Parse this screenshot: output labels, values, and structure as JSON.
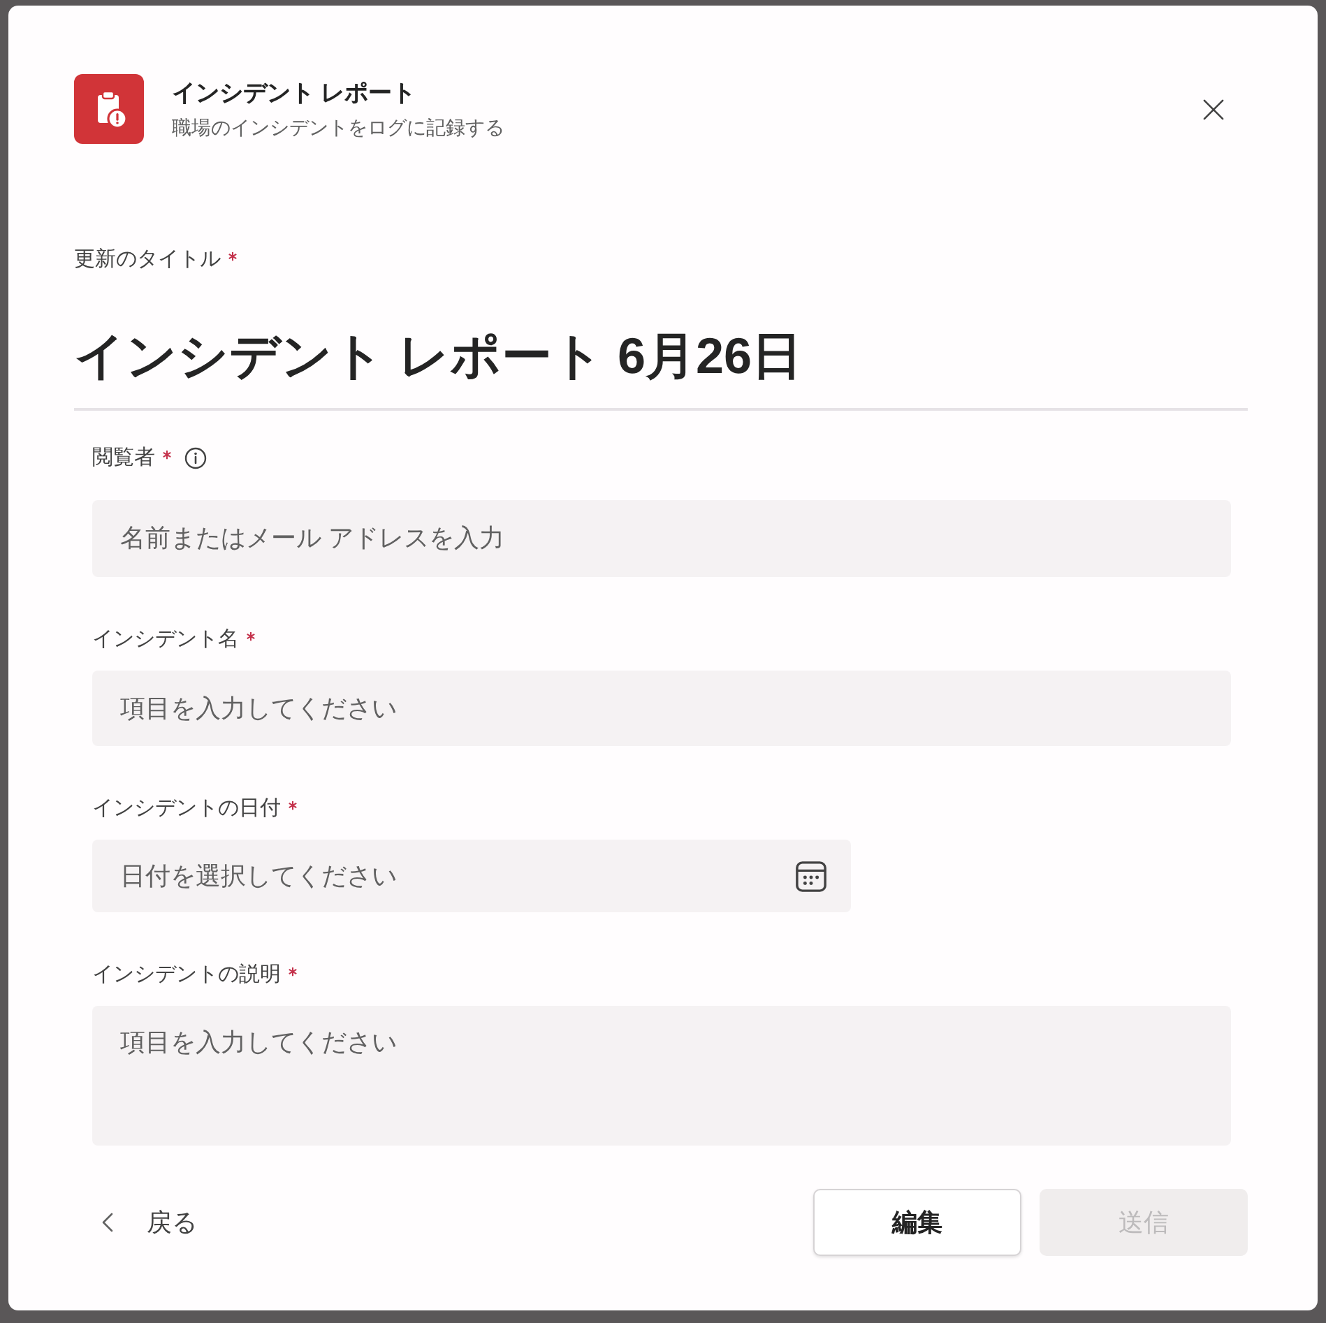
{
  "header": {
    "title": "インシデント レポート",
    "subtitle": "職場のインシデントをログに記録する"
  },
  "title_field": {
    "label": "更新のタイトル",
    "required": true,
    "value": "インシデント レポート 6月26日"
  },
  "fields": [
    {
      "kind": "people",
      "label": "閲覧者",
      "required": true,
      "info": true,
      "placeholder": "名前またはメール アドレスを入力"
    },
    {
      "kind": "text",
      "label": "インシデント名",
      "required": true,
      "info": false,
      "placeholder": "項目を入力してください"
    },
    {
      "kind": "date",
      "label": "インシデントの日付",
      "required": true,
      "info": false,
      "placeholder": "日付を選択してください"
    },
    {
      "kind": "multiline",
      "label": "インシデントの説明",
      "required": true,
      "info": false,
      "placeholder": "項目を入力してください"
    }
  ],
  "footer": {
    "back": "戻る",
    "buttons": [
      {
        "label": "編集",
        "disabled": false
      },
      {
        "label": "送信",
        "disabled": true
      }
    ]
  }
}
